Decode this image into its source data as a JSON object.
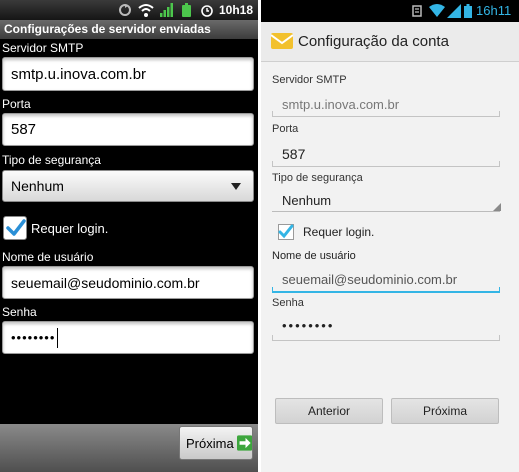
{
  "left": {
    "status_time": "10h18",
    "title": "Configurações de servidor enviadas",
    "smtp": {
      "label": "Servidor SMTP",
      "value": "smtp.u.inova.com.br"
    },
    "port": {
      "label": "Porta",
      "value": "587"
    },
    "security": {
      "label": "Tipo de segurança",
      "value": "Nenhum"
    },
    "login": {
      "label": "Requer login.",
      "checked": true
    },
    "username": {
      "label": "Nome de usuário",
      "value": "seuemail@seudominio.com.br"
    },
    "password": {
      "label": "Senha",
      "value": "••••••••"
    },
    "next_button": "Próxima"
  },
  "right": {
    "status_time": "16h11",
    "title": "Configuração da conta",
    "smtp": {
      "label": "Servidor SMTP",
      "value": "smtp.u.inova.com.br"
    },
    "port": {
      "label": "Porta",
      "value": "587"
    },
    "security": {
      "label": "Tipo de segurança",
      "value": "Nenhum"
    },
    "login": {
      "label": "Requer login.",
      "checked": true
    },
    "username": {
      "label": "Nome de usuário",
      "value": "seuemail@seudominio.com.br"
    },
    "password": {
      "label": "Senha",
      "value": "••••••••"
    },
    "prev_button": "Anterior",
    "next_button": "Próxima"
  },
  "colors": {
    "accent_blue": "#33b5e5",
    "check_blue": "#2a8fd6",
    "next_green": "#3da63d"
  }
}
